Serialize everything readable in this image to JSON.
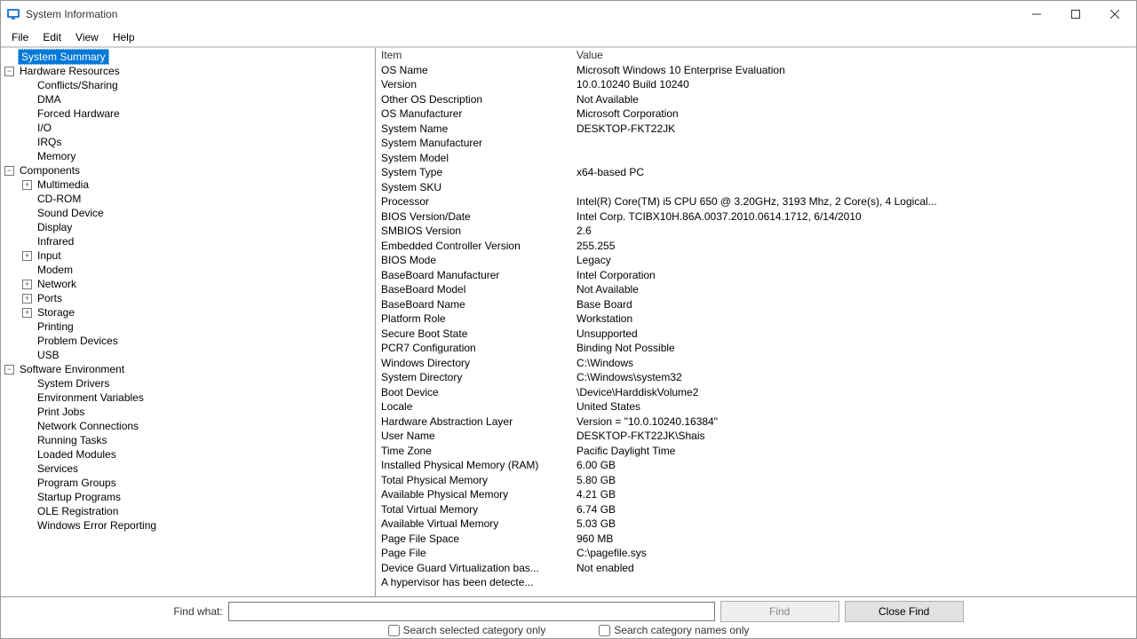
{
  "window": {
    "title": "System Information"
  },
  "menus": {
    "file": "File",
    "edit": "Edit",
    "view": "View",
    "help": "Help"
  },
  "tree": {
    "root": "System Summary",
    "hw": "Hardware Resources",
    "hw_items": [
      "Conflicts/Sharing",
      "DMA",
      "Forced Hardware",
      "I/O",
      "IRQs",
      "Memory"
    ],
    "cmp": "Components",
    "cmp_mm": "Multimedia",
    "cmp_items1": [
      "CD-ROM",
      "Sound Device",
      "Display",
      "Infrared"
    ],
    "cmp_input": "Input",
    "cmp_items2": [
      "Modem"
    ],
    "cmp_network": "Network",
    "cmp_ports": "Ports",
    "cmp_storage": "Storage",
    "cmp_items3": [
      "Printing",
      "Problem Devices",
      "USB"
    ],
    "se": "Software Environment",
    "se_items": [
      "System Drivers",
      "Environment Variables",
      "Print Jobs",
      "Network Connections",
      "Running Tasks",
      "Loaded Modules",
      "Services",
      "Program Groups",
      "Startup Programs",
      "OLE Registration",
      "Windows Error Reporting"
    ]
  },
  "columns": {
    "item": "Item",
    "value": "Value"
  },
  "rows": [
    {
      "k": "OS Name",
      "v": "Microsoft Windows 10 Enterprise Evaluation"
    },
    {
      "k": "Version",
      "v": "10.0.10240 Build 10240"
    },
    {
      "k": "Other OS Description",
      "v": "Not Available"
    },
    {
      "k": "OS Manufacturer",
      "v": "Microsoft Corporation"
    },
    {
      "k": "System Name",
      "v": "DESKTOP-FKT22JK"
    },
    {
      "k": "System Manufacturer",
      "v": ""
    },
    {
      "k": "System Model",
      "v": ""
    },
    {
      "k": "System Type",
      "v": "x64-based PC"
    },
    {
      "k": "System SKU",
      "v": ""
    },
    {
      "k": "Processor",
      "v": "Intel(R) Core(TM) i5 CPU         650  @ 3.20GHz, 3193 Mhz, 2 Core(s), 4 Logical..."
    },
    {
      "k": "BIOS Version/Date",
      "v": "Intel Corp. TCIBX10H.86A.0037.2010.0614.1712, 6/14/2010"
    },
    {
      "k": "SMBIOS Version",
      "v": "2.6"
    },
    {
      "k": "Embedded Controller Version",
      "v": "255.255"
    },
    {
      "k": "BIOS Mode",
      "v": "Legacy"
    },
    {
      "k": "BaseBoard Manufacturer",
      "v": "Intel Corporation"
    },
    {
      "k": "BaseBoard Model",
      "v": "Not Available"
    },
    {
      "k": "BaseBoard Name",
      "v": "Base Board"
    },
    {
      "k": "Platform Role",
      "v": "Workstation"
    },
    {
      "k": "Secure Boot State",
      "v": "Unsupported"
    },
    {
      "k": "PCR7 Configuration",
      "v": "Binding Not Possible"
    },
    {
      "k": "Windows Directory",
      "v": "C:\\Windows"
    },
    {
      "k": "System Directory",
      "v": "C:\\Windows\\system32"
    },
    {
      "k": "Boot Device",
      "v": "\\Device\\HarddiskVolume2"
    },
    {
      "k": "Locale",
      "v": "United States"
    },
    {
      "k": "Hardware Abstraction Layer",
      "v": "Version = \"10.0.10240.16384\""
    },
    {
      "k": "User Name",
      "v": "DESKTOP-FKT22JK\\Shais"
    },
    {
      "k": "Time Zone",
      "v": "Pacific Daylight Time"
    },
    {
      "k": "Installed Physical Memory (RAM)",
      "v": "6.00 GB"
    },
    {
      "k": "Total Physical Memory",
      "v": "5.80 GB"
    },
    {
      "k": "Available Physical Memory",
      "v": "4.21 GB"
    },
    {
      "k": "Total Virtual Memory",
      "v": "6.74 GB"
    },
    {
      "k": "Available Virtual Memory",
      "v": "5.03 GB"
    },
    {
      "k": "Page File Space",
      "v": "960 MB"
    },
    {
      "k": "Page File",
      "v": "C:\\pagefile.sys"
    },
    {
      "k": "Device Guard Virtualization bas...",
      "v": "Not enabled"
    },
    {
      "k": "A hypervisor has been detecte...",
      "v": ""
    }
  ],
  "find": {
    "label": "Find what:",
    "value": "",
    "find_btn": "Find",
    "close_btn": "Close Find",
    "opt1": "Search selected category only",
    "opt2": "Search category names only"
  }
}
